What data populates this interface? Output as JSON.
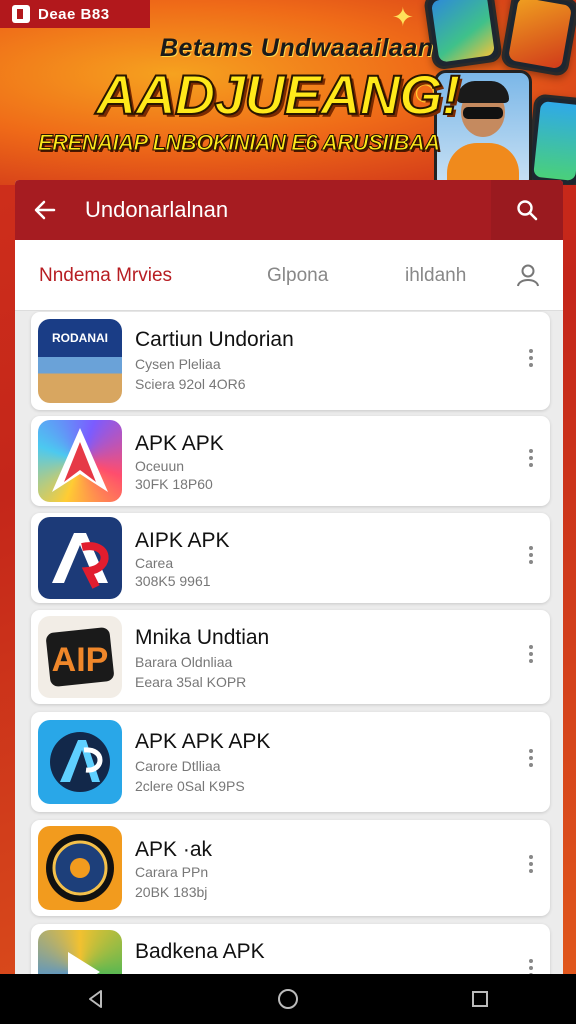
{
  "status_bar": {
    "text": "Deae B83"
  },
  "banner": {
    "line1": "Betams Undwaaailaan",
    "line2": "AADJUEANG!",
    "line3": "ERENAIAP LNBOKINIAN E6 ARUSIIBAA"
  },
  "header": {
    "title": "Undonarlalnan",
    "back_icon": "arrow-left-icon",
    "search_icon": "search-icon"
  },
  "tabs": [
    {
      "label": "Nndema Mrvies",
      "active": true
    },
    {
      "label": "Glpona",
      "active": false
    },
    {
      "label": "ihldanh",
      "active": false
    }
  ],
  "apps": [
    {
      "name": "Cartiun Undorian",
      "line1": "Cysen Pleliaa",
      "line2": "Sciera 92ol 4OR6",
      "icon_text": "RODANAI"
    },
    {
      "name": "APK APK",
      "line1": "Oceuun",
      "line2": "30FK 18P60"
    },
    {
      "name": "AIPK APK",
      "line1": "Carea",
      "line2": "308K5 9961"
    },
    {
      "name": "Mnika Undtian",
      "line1": "Barara Oldnliaa",
      "line2": "Eeara 35al KOPR",
      "icon_text": "AIP"
    },
    {
      "name": "APK  APK APK",
      "line1": "Carore Dtlliaa",
      "line2": "2clere 0Sal K9PS"
    },
    {
      "name": "APK ·ak",
      "line1": "Carara PPn",
      "line2": "20BK 183bj"
    },
    {
      "name": "Badkena APK",
      "line1": "",
      "line2": ""
    }
  ],
  "colors": {
    "accent": "#b71d22",
    "appbar": "#a61c21"
  }
}
